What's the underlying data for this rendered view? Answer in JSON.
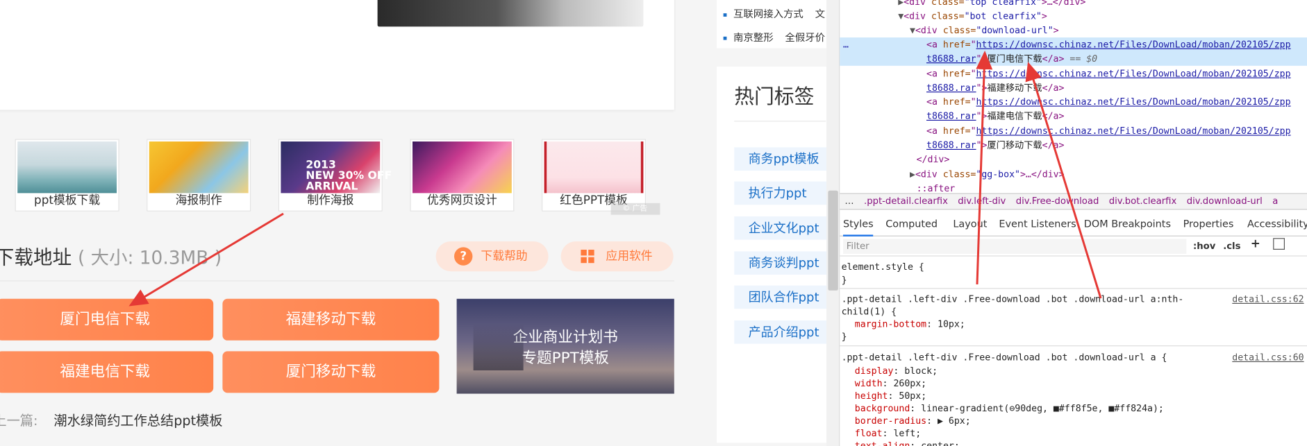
{
  "web": {
    "thumbs": [
      "ppt模板下载",
      "海报制作",
      "制作海报",
      "优秀网页设计",
      "红色PPT模板"
    ],
    "thumb3_art": "2013\nNEW 30% OFF\nARRIVAL",
    "watermark": "© 广告",
    "download_title": "下载地址",
    "download_size": "( 大小: 10.3MB )",
    "help_label": "下载帮助",
    "soft_label": "应用软件",
    "buttons": [
      "厦门电信下载",
      "福建移动下载",
      "福建电信下载",
      "厦门移动下载"
    ],
    "ad_line1": "企业商业计划书",
    "ad_line2": "专题PPT模板",
    "prev_label": "上一篇:",
    "prev_title": "潮水绿简约工作总结ppt模板",
    "right_rows": [
      "互联网接入方式",
      "南京整形"
    ],
    "right_rows_tail": [
      "文",
      "全假牙价"
    ],
    "hot_title": "热门标签",
    "tags": [
      "商务ppt模板",
      "执行力ppt",
      "企业文化ppt",
      "商务谈判ppt",
      "团队合作ppt",
      "产品介绍ppt"
    ]
  },
  "devtools": {
    "elements": [
      {
        "indent": 1,
        "tri": "▶",
        "pre": "<",
        "tag": "div",
        "attr": " class=",
        "val": "\"top clearfix\"",
        "post": ">…</div>"
      },
      {
        "indent": 1,
        "tri": "▼",
        "pre": "<",
        "tag": "div",
        "attr": " class=",
        "val": "\"bot clearfix\"",
        "post": ">"
      },
      {
        "indent": 2,
        "tri": "▼",
        "pre": "<",
        "tag": "div",
        "attr": " class=",
        "val": "\"download-url\"",
        "post": ">"
      }
    ],
    "links": [
      {
        "url1": "https://downsc.chinaz.net/Files/DownLoad/moban/202105/zpp",
        "url2": "t8688.rar",
        "text": "厦门电信下载",
        "selected": true,
        "suffix": " == $0"
      },
      {
        "url1": "https://downsc.chinaz.net/Files/DownLoad/moban/202105/zpp",
        "url2": "t8688.rar",
        "text": "福建移动下载",
        "selected": false,
        "suffix": ""
      },
      {
        "url1": "https://downsc.chinaz.net/Files/DownLoad/moban/202105/zpp",
        "url2": "t8688.rar",
        "text": "福建电信下载",
        "selected": false,
        "suffix": ""
      },
      {
        "url1": "https://downsc.chinaz.net/Files/DownLoad/moban/202105/zpp",
        "url2": "t8688.rar",
        "text": "厦门移动下载",
        "selected": false,
        "suffix": ""
      }
    ],
    "close_div": "</div>",
    "gg_box": {
      "pre": "<",
      "tag": "div",
      "attr": " class=",
      "val": "\"gg-box\"",
      "post": ">…</div>"
    },
    "after": "::after",
    "breadcrumbs": [
      "…",
      ".ppt-detail.clearfix",
      "div.left-div",
      "div.Free-download",
      "div.bot.clearfix",
      "div.download-url",
      "a"
    ],
    "tabs": [
      "Styles",
      "Computed",
      "Layout",
      "Event Listeners",
      "DOM Breakpoints",
      "Properties",
      "Accessibility"
    ],
    "filter_placeholder": "Filter",
    "filter_hov": ":hov",
    "filter_cls": ".cls",
    "filter_plus": "+",
    "rule0": {
      "selector": "element.style {",
      "close": "}"
    },
    "rule1": {
      "selector": ".ppt-detail .left-div .Free-download .bot .download-url a:nth-",
      "selector2": "child(1) {",
      "link": "detail.css:62",
      "props": [
        {
          "name": "margin-bottom",
          "value": "10px;"
        }
      ],
      "close": "}"
    },
    "rule2": {
      "selector": ".ppt-detail .left-div .Free-download .bot .download-url a {",
      "link": "detail.css:60",
      "props": [
        {
          "name": "display",
          "value": "block;"
        },
        {
          "name": "width",
          "value": "260px;"
        },
        {
          "name": "height",
          "value": "50px;"
        },
        {
          "name": "background",
          "value": "linear-gradient(⊖90deg, ■#ff8f5e, ■#ff824a);"
        },
        {
          "name": "border-radius",
          "value": "▶ 6px;"
        },
        {
          "name": "float",
          "value": "left;"
        },
        {
          "name": "text-align",
          "value": "center;"
        }
      ]
    },
    "colors": {
      "c1": "#ff8f5e",
      "c2": "#ff824a"
    }
  },
  "colors": {
    "accent": "#ff824a",
    "link_blue": "#1a6fc7",
    "arrow": "#e53935"
  }
}
